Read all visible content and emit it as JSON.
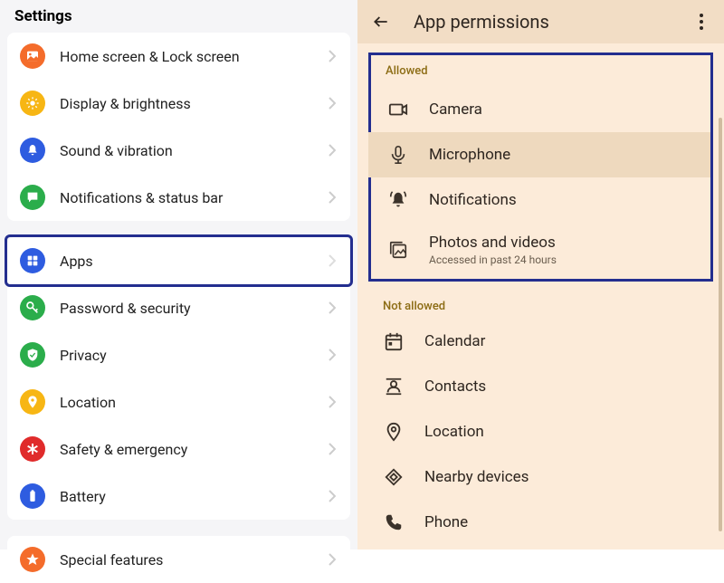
{
  "settings": {
    "title": "Settings",
    "groups": [
      [
        {
          "id": "home",
          "label": "Home screen & Lock screen",
          "icon": "home-image-icon",
          "bg": "#f46c2b"
        },
        {
          "id": "display",
          "label": "Display & brightness",
          "icon": "brightness-icon",
          "bg": "#f7b614"
        },
        {
          "id": "sound",
          "label": "Sound & vibration",
          "icon": "bell-icon",
          "bg": "#2e5ce0"
        },
        {
          "id": "notifications",
          "label": "Notifications & status bar",
          "icon": "chat-settings-icon",
          "bg": "#2bad4b"
        }
      ],
      [
        {
          "id": "apps",
          "label": "Apps",
          "icon": "apps-grid-icon",
          "bg": "#2e5ce0",
          "highlighted": true
        },
        {
          "id": "password",
          "label": "Password & security",
          "icon": "key-icon",
          "bg": "#2bad4b"
        },
        {
          "id": "privacy",
          "label": "Privacy",
          "icon": "shield-icon",
          "bg": "#2bad4b"
        },
        {
          "id": "location",
          "label": "Location",
          "icon": "location-pin-icon",
          "bg": "#f7b614"
        },
        {
          "id": "safety",
          "label": "Safety & emergency",
          "icon": "asterisk-icon",
          "bg": "#e02b2b"
        },
        {
          "id": "battery",
          "label": "Battery",
          "icon": "battery-icon",
          "bg": "#2e5ce0"
        }
      ],
      [
        {
          "id": "special",
          "label": "Special features",
          "icon": "star-icon",
          "bg": "#f46c2b"
        }
      ]
    ]
  },
  "permissions": {
    "header": "App permissions",
    "allowed_label": "Allowed",
    "not_allowed_label": "Not allowed",
    "allowed": [
      {
        "id": "camera",
        "label": "Camera",
        "icon": "camera-icon"
      },
      {
        "id": "microphone",
        "label": "Microphone",
        "icon": "microphone-icon",
        "hover": true
      },
      {
        "id": "notifications",
        "label": "Notifications",
        "icon": "bell-ring-icon"
      },
      {
        "id": "photos",
        "label": "Photos and videos",
        "sub": "Accessed in past 24 hours",
        "icon": "photos-icon"
      }
    ],
    "not_allowed": [
      {
        "id": "calendar",
        "label": "Calendar",
        "icon": "calendar-icon"
      },
      {
        "id": "contacts",
        "label": "Contacts",
        "icon": "contacts-icon"
      },
      {
        "id": "location",
        "label": "Location",
        "icon": "location-outline-icon"
      },
      {
        "id": "nearby",
        "label": "Nearby devices",
        "icon": "nearby-icon"
      },
      {
        "id": "phone",
        "label": "Phone",
        "icon": "phone-icon"
      }
    ]
  },
  "colors": {
    "highlight": "#232e8f",
    "left_bg": "#f5f5f7",
    "right_bg": "#fcebd9"
  }
}
